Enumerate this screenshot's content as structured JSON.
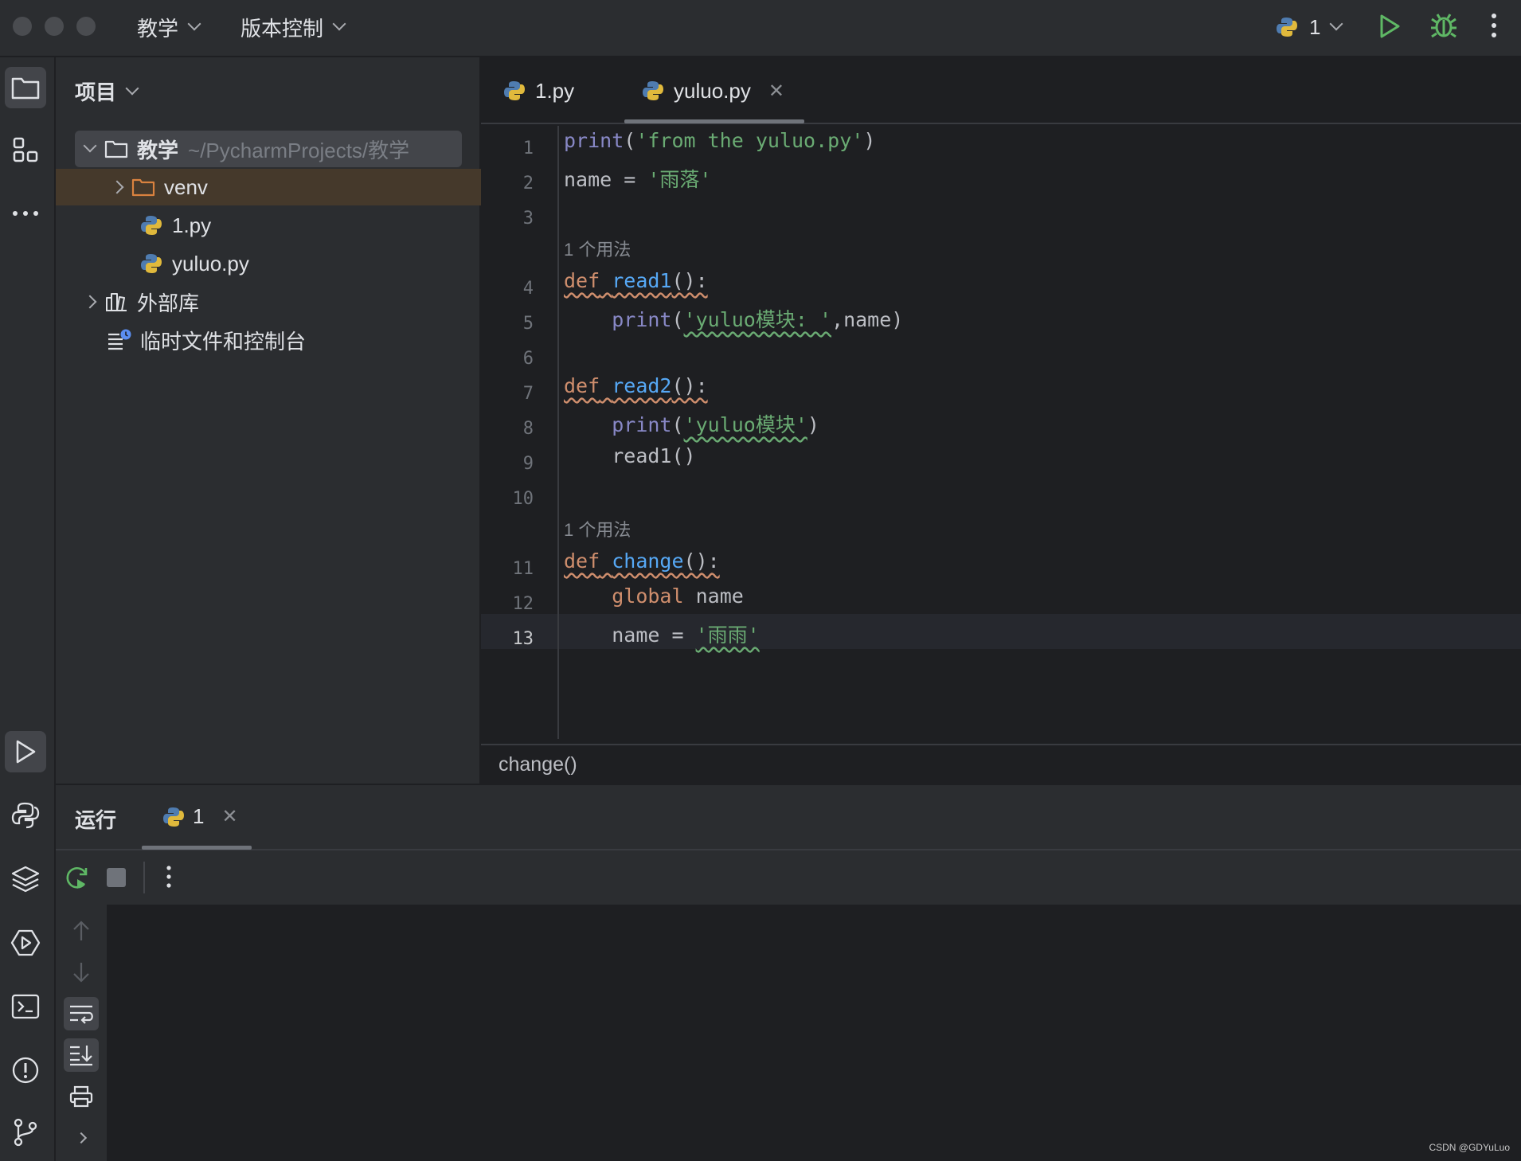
{
  "titlebar": {
    "project_menu": "教学",
    "vcs_menu": "版本控制",
    "run_config": "1"
  },
  "project_panel": {
    "title": "项目",
    "tree": {
      "root_name": "教学",
      "root_path": "~/PycharmProjects/教学",
      "venv": "venv",
      "file1": "1.py",
      "file2": "yuluo.py",
      "external_libs": "外部库",
      "scratches": "临时文件和控制台"
    }
  },
  "editor": {
    "tabs": [
      {
        "label": "1.py",
        "active": false
      },
      {
        "label": "yuluo.py",
        "active": true
      }
    ],
    "line_numbers": [
      "1",
      "2",
      "3",
      "4",
      "5",
      "6",
      "7",
      "8",
      "9",
      "10",
      "11",
      "12",
      "13"
    ],
    "current_line": 13,
    "usage_hint": "1 个用法",
    "code": {
      "l1_fn": "print",
      "l1_str": "'from the yuluo.py'",
      "l2_var": "name",
      "l2_str": "'雨落'",
      "l4_kw": "def",
      "l4_fn": "read1",
      "l5_fn": "print",
      "l5_str": "'yuluo模块: '",
      "l5_arg": "name",
      "l7_kw": "def",
      "l7_fn": "read2",
      "l8_fn": "print",
      "l8_str": "'yuluo模块'",
      "l9_call": "read1()",
      "l11_kw": "def",
      "l11_fn": "change",
      "l12_kw": "global",
      "l12_var": "name",
      "l13_var": "name",
      "l13_str": "'雨雨'"
    },
    "breadcrumb": "change()"
  },
  "run_panel": {
    "title": "运行",
    "tab_label": "1"
  },
  "watermark": "CSDN @GDYuLuo",
  "colors": {
    "keyword": "#cf8e6d",
    "function": "#56a8f5",
    "builtin": "#8888c6",
    "string": "#6aab73",
    "run_green": "#5fb865"
  }
}
